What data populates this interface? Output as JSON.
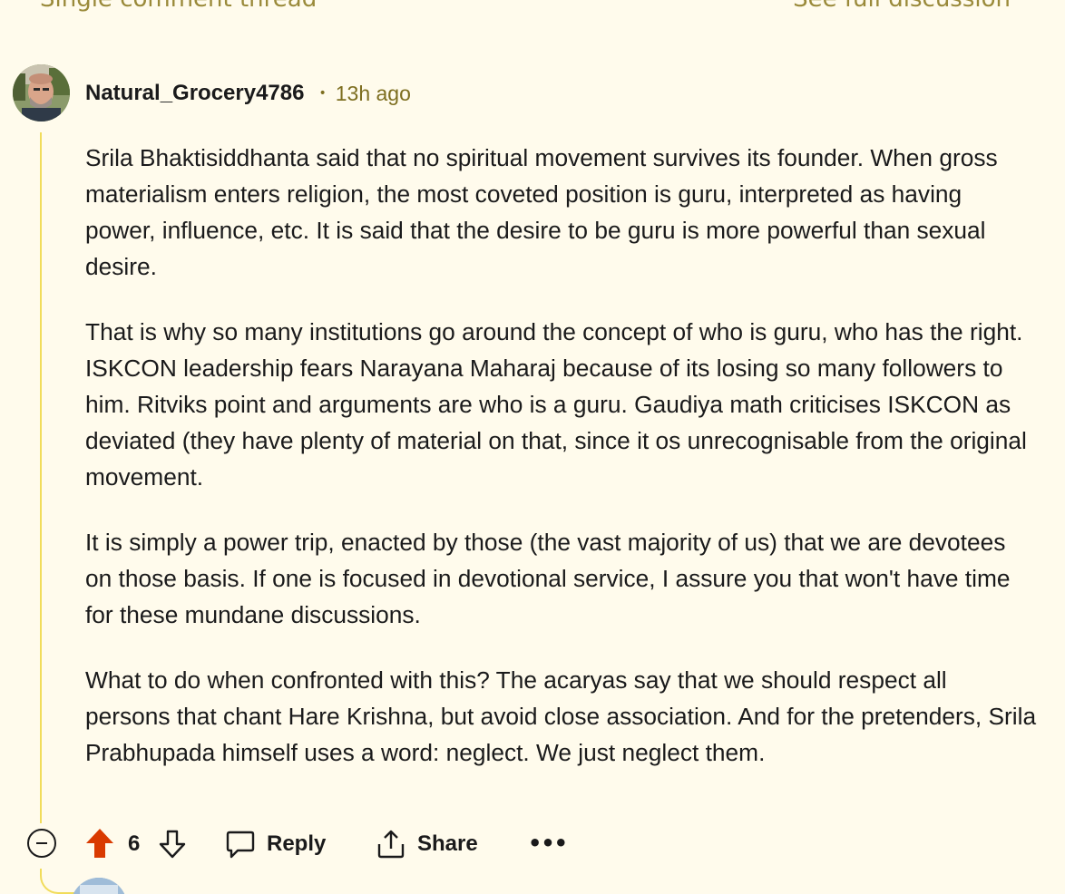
{
  "top_links": {
    "left": "Single comment thread",
    "right": "See full discussion"
  },
  "comment": {
    "username": "Natural_Grocery4786",
    "separator": "•",
    "time_ago": "13h ago",
    "paragraphs": [
      "Srila Bhaktisiddhanta said that no spiritual movement survives its founder. When gross materialism enters religion, the most coveted position is guru, interpreted as having power, influence, etc. It is said that the desire to be guru is more powerful than sexual desire.",
      "That is why so many institutions go around the concept of who is guru, who has the right. ISKCON leadership fears Narayana Maharaj because of its losing so many followers to him. Ritviks point and arguments are who is a guru. Gaudiya math criticises ISKCON as deviated (they have plenty of material on that, since it os unrecognisable from the original movement.",
      "It is simply a power trip, enacted by those (the vast majority of us) that we are devotees on those basis. If one is focused in devotional service, I assure you that won't have time for these mundane discussions.",
      "What to do when confronted with this? The acaryas say that we should respect all persons that chant Hare Krishna, but avoid close association. And for the pretenders, Srila Prabhupada himself uses a word: neglect. We just neglect them."
    ],
    "score": "6",
    "reply_label": "Reply",
    "share_label": "Share",
    "more_label": "•••"
  },
  "icons": {
    "collapse": "collapse-minus-icon",
    "upvote": "upvote-arrow-icon",
    "downvote": "downvote-arrow-icon",
    "reply": "comment-bubble-icon",
    "share": "share-icon",
    "more": "more-options-icon"
  },
  "colors": {
    "background": "#fffbec",
    "thread_line": "#f1dc5b",
    "upvote_active": "#d93a00",
    "meta_text": "#7d6e1f"
  }
}
